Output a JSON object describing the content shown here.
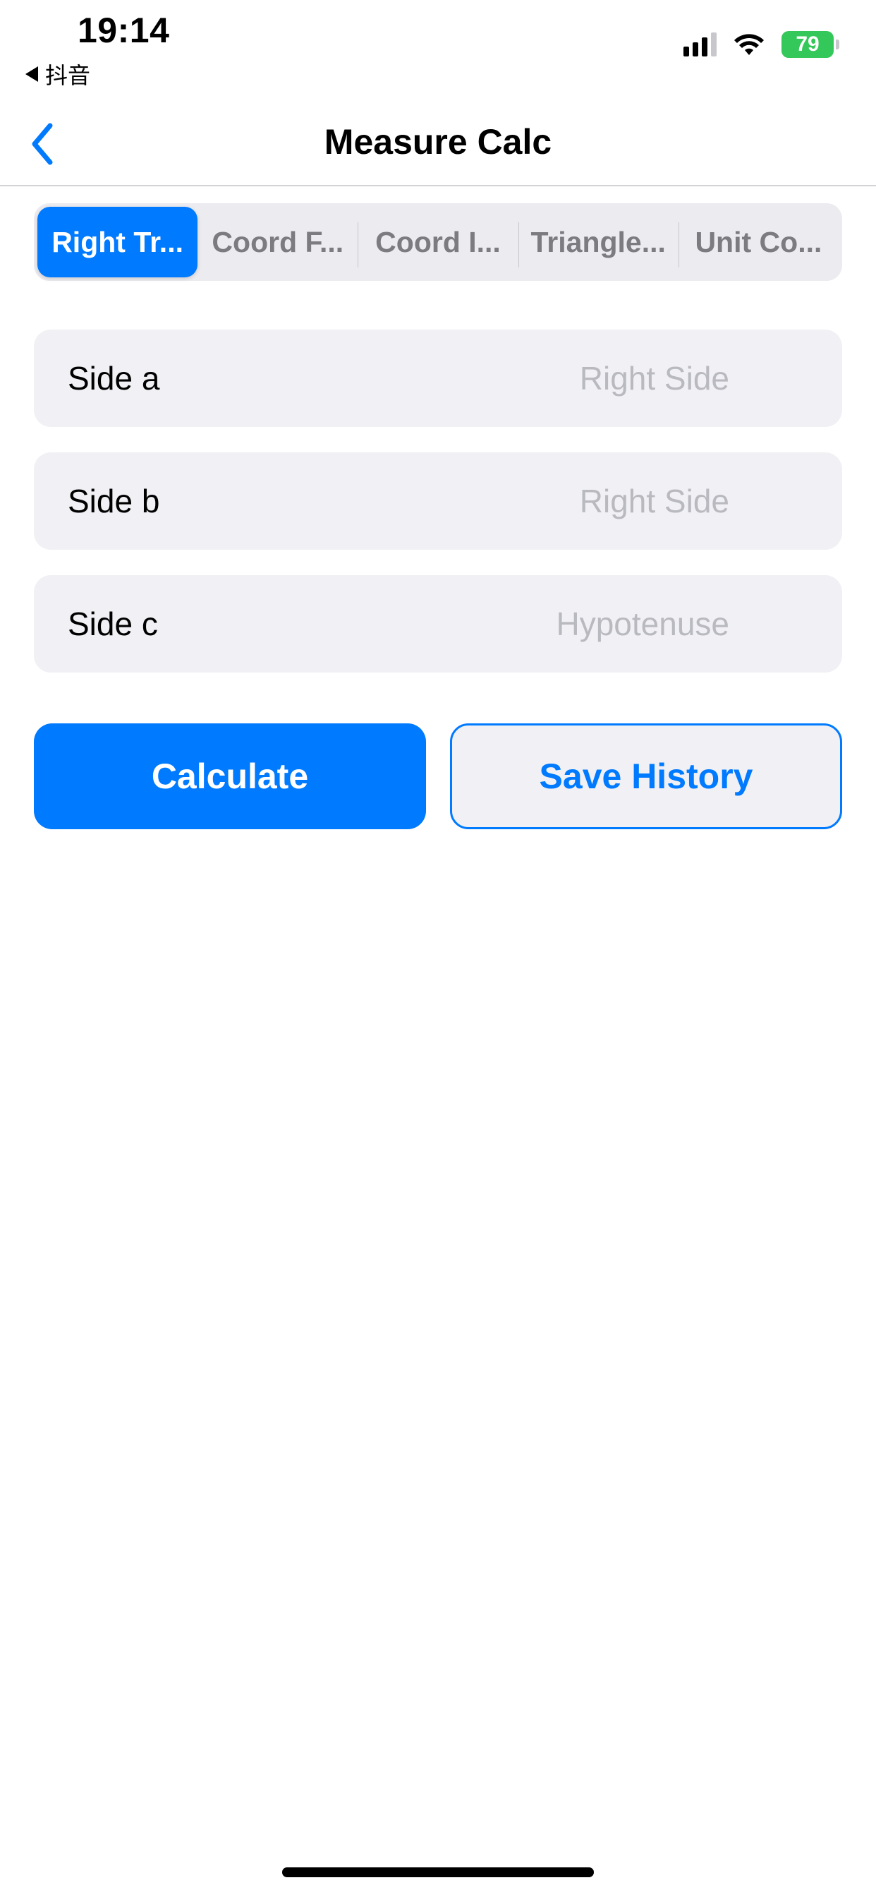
{
  "status_bar": {
    "time": "19:14",
    "back_app": "抖音",
    "battery": "79"
  },
  "nav": {
    "back_icon": "chevron-left-icon",
    "title": "Measure Calc"
  },
  "tabs": [
    {
      "label": "Right Tr...",
      "active": true
    },
    {
      "label": "Coord F...",
      "active": false
    },
    {
      "label": "Coord I...",
      "active": false
    },
    {
      "label": "Triangle...",
      "active": false
    },
    {
      "label": "Unit Co...",
      "active": false
    }
  ],
  "fields": [
    {
      "label": "Side a",
      "value": "",
      "placeholder": "Right Side"
    },
    {
      "label": "Side b",
      "value": "",
      "placeholder": "Right Side"
    },
    {
      "label": "Side c",
      "value": "",
      "placeholder": "Hypotenuse"
    }
  ],
  "buttons": {
    "calculate": "Calculate",
    "save_history": "Save History"
  },
  "colors": {
    "accent": "#007aff",
    "field_bg": "#f1f1f5",
    "battery": "#34c759"
  }
}
